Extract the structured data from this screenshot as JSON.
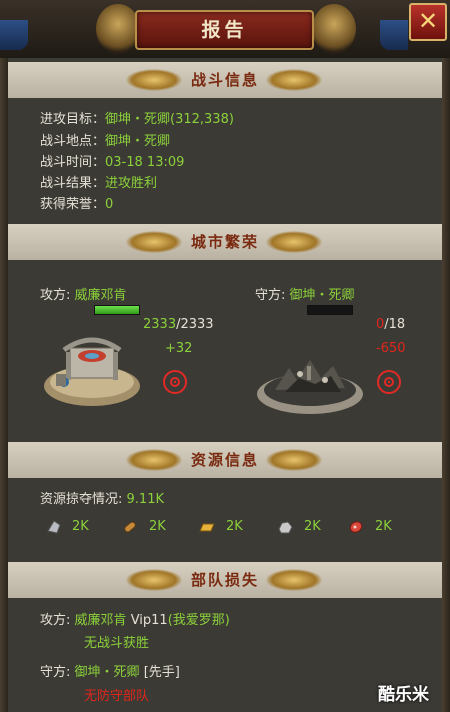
{
  "window": {
    "title": "报告",
    "close_label": "✕"
  },
  "battle_info": {
    "header": "战斗信息",
    "target_label": "进攻目标：",
    "target_value": "御坤・死卿(312,338)",
    "location_label": "战斗地点：",
    "location_value": "御坤・死卿",
    "time_label": "战斗时间：",
    "time_value": "03-18 13:09",
    "result_label": "战斗结果：",
    "result_value": "进攻胜利",
    "honor_label": "获得荣誉：",
    "honor_value": "0"
  },
  "city_prosperity": {
    "header": "城市繁荣",
    "attacker_label": "攻方:",
    "attacker_name": "威廉邓肯",
    "attacker_hp_current": "2333",
    "attacker_hp_max": "/2333",
    "attacker_hp_fraction": 1.0,
    "attacker_change": "+32",
    "defender_label": "守方:",
    "defender_name": "御坤・死卿",
    "defender_hp_current": "0",
    "defender_hp_max": "/18",
    "defender_hp_fraction": 0.0,
    "defender_change": "-650"
  },
  "resource_info": {
    "header": "资源信息",
    "plunder_label": "资源掠夺情况:",
    "plunder_value": "9.11K",
    "items": [
      {
        "icon": "iron-ore-icon",
        "value": "2K"
      },
      {
        "icon": "wood-log-icon",
        "value": "2K"
      },
      {
        "icon": "gold-bar-icon",
        "value": "2K"
      },
      {
        "icon": "stone-icon",
        "value": "2K"
      },
      {
        "icon": "meat-icon",
        "value": "2K"
      }
    ]
  },
  "troop_loss": {
    "header": "部队损失",
    "attacker_label": "攻方:",
    "attacker_name": "威廉邓肯",
    "attacker_vip": "Vip11",
    "attacker_alliance": "(我爱罗那)",
    "attacker_status": "无战斗获胜",
    "defender_label": "守方:",
    "defender_name": "御坤・死卿",
    "defender_tag": "[先手]",
    "defender_status": "无防守部队"
  },
  "watermark": "酷乐米",
  "colors": {
    "green": "#8bd13a",
    "red": "#e0261b",
    "header_bg": "#c9c2b2",
    "title_red": "#7a2a10"
  }
}
